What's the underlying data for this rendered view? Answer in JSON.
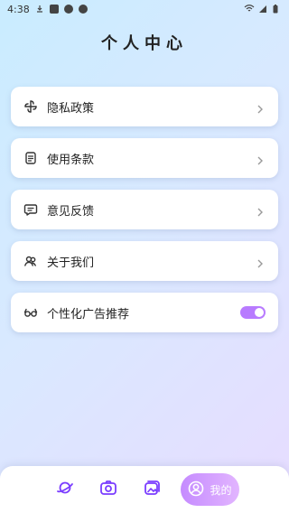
{
  "status": {
    "time": "4:38",
    "right_icons": [
      "wifi-icon",
      "signal-icon",
      "battery-icon"
    ],
    "left_icons": [
      "download-icon",
      "a-icon",
      "circle-icon",
      "bus-icon"
    ]
  },
  "page": {
    "title": "个人中心"
  },
  "menu": {
    "items": [
      {
        "label": "隐私政策",
        "icon": "pinwheel-icon"
      },
      {
        "label": "使用条款",
        "icon": "document-icon"
      },
      {
        "label": "意见反馈",
        "icon": "chat-icon"
      },
      {
        "label": "关于我们",
        "icon": "people-icon"
      },
      {
        "label": "个性化广告推荐",
        "icon": "glasses-icon",
        "toggle_on": true
      }
    ]
  },
  "colors": {
    "accent": "#b87bff",
    "tab_active_start": "#c58bff",
    "tab_active_end": "#e2b5ff"
  },
  "tabbar": {
    "tabs": [
      {
        "icon": "planet-icon"
      },
      {
        "icon": "camera-icon"
      },
      {
        "icon": "album-icon"
      },
      {
        "icon": "user-icon",
        "label": "我的",
        "active": true
      }
    ]
  }
}
